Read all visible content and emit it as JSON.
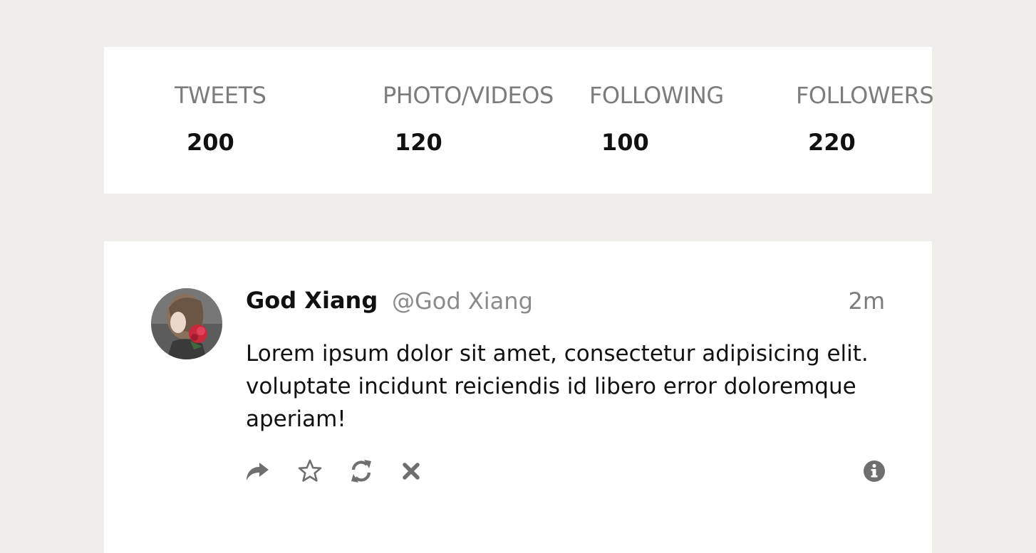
{
  "stats": [
    {
      "label": "TWEETS",
      "value": "200"
    },
    {
      "label": "PHOTO/VIDEOS",
      "value": "120"
    },
    {
      "label": "FOLLOWING",
      "value": "100"
    },
    {
      "label": "FOLLOWERS",
      "value": "220"
    }
  ],
  "tweet": {
    "author_name": "God Xiang",
    "author_handle": "@God Xiang",
    "timestamp": "2m",
    "text": "Lorem ipsum dolor sit amet, consectetur adipisicing elit. voluptate incidunt reiciendis id libero error doloremque aperiam!",
    "actions": {
      "reply_icon": "share-arrow-icon",
      "favorite_icon": "star-icon",
      "retweet_icon": "refresh-icon",
      "delete_icon": "close-icon",
      "info_icon": "info-icon"
    }
  },
  "colors": {
    "page_background": "#efeeea",
    "card_background": "#ffffff",
    "icon_gray": "#6f6f6f"
  }
}
